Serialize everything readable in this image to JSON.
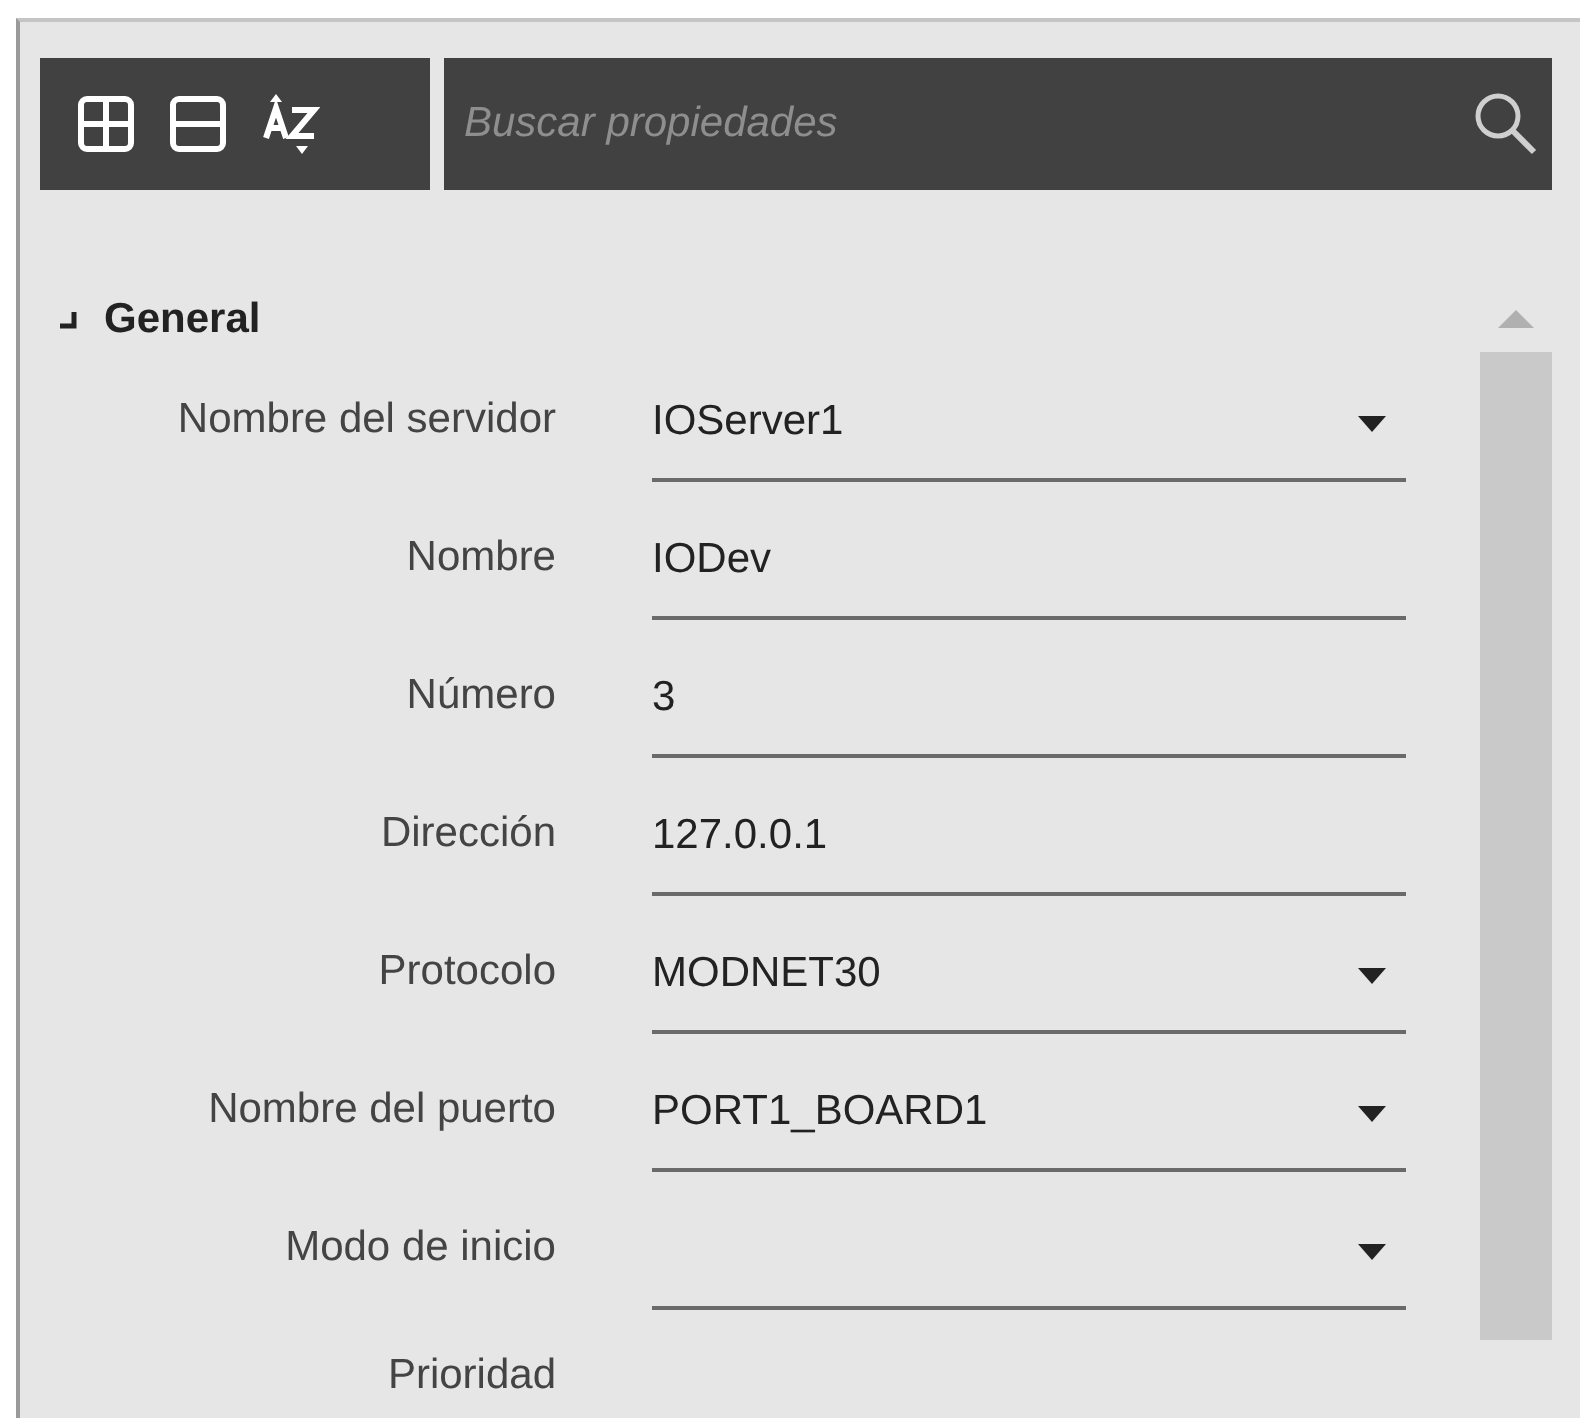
{
  "toolbar": {
    "search": {
      "placeholder": "Buscar propiedades"
    }
  },
  "group": {
    "title": "General",
    "expanded": true
  },
  "properties": [
    {
      "label": "Nombre del servidor",
      "kind": "dropdown",
      "value": "IOServer1"
    },
    {
      "label": "Nombre",
      "kind": "text",
      "value": "IODev"
    },
    {
      "label": "Número",
      "kind": "text",
      "value": "3"
    },
    {
      "label": "Dirección",
      "kind": "text",
      "value": "127.0.0.1"
    },
    {
      "label": "Protocolo",
      "kind": "dropdown",
      "value": "MODNET30"
    },
    {
      "label": "Nombre del puerto",
      "kind": "dropdown",
      "value": "PORT1_BOARD1"
    },
    {
      "label": "Modo de inicio",
      "kind": "dropdown"
    },
    {
      "label": "Prioridad",
      "kind": "partial"
    }
  ]
}
